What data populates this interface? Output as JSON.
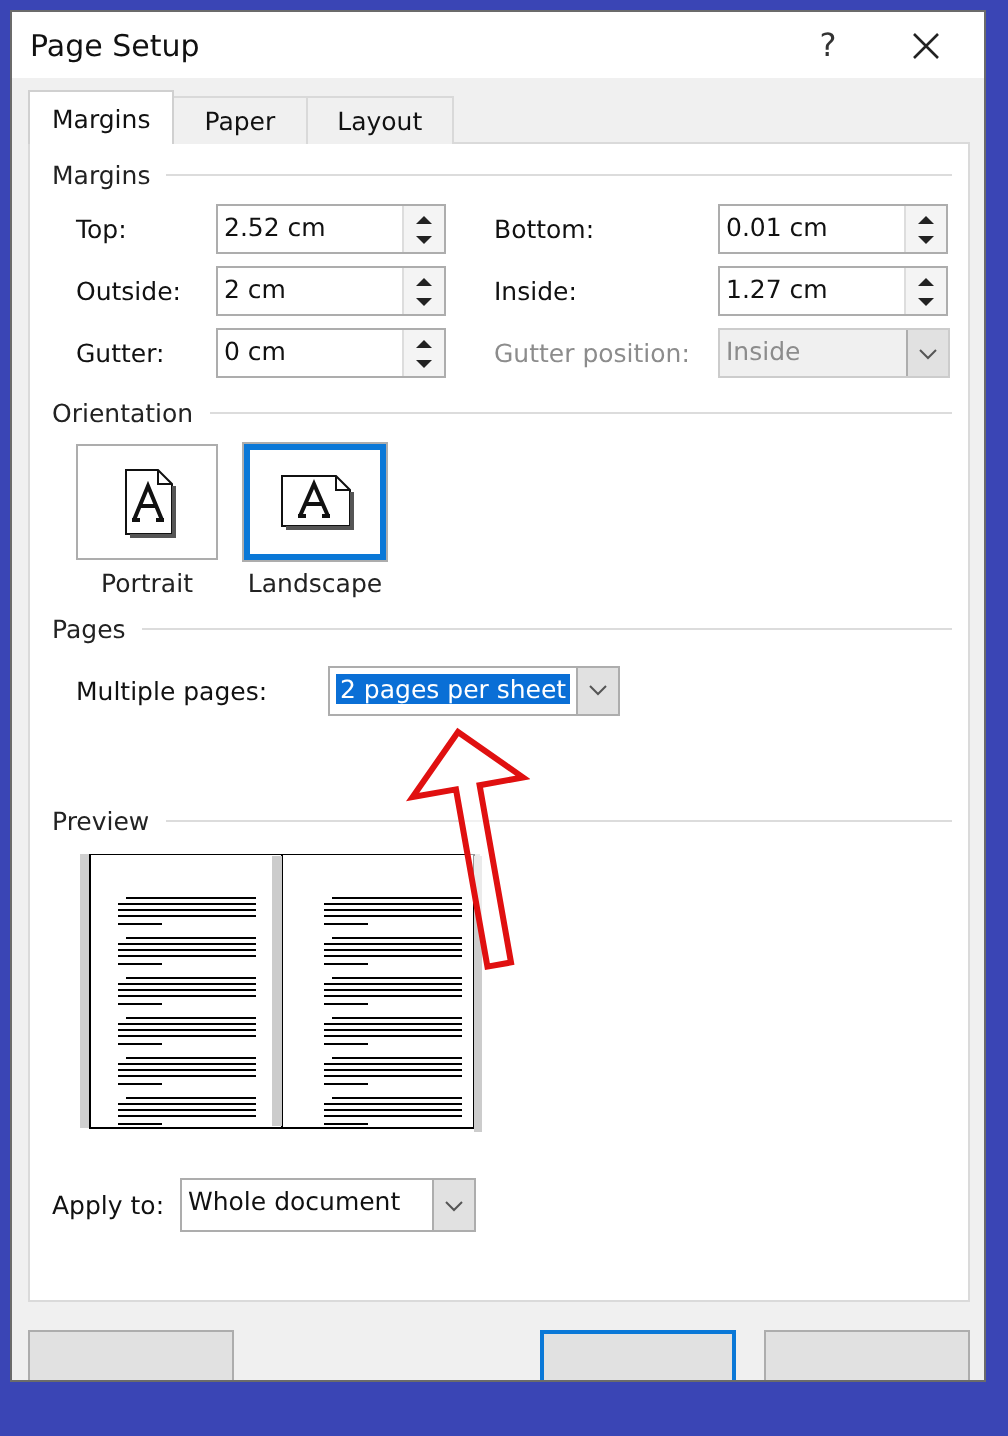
{
  "window": {
    "title": "Page Setup",
    "help": "?"
  },
  "tabs": [
    {
      "label": "Margins",
      "selected": true
    },
    {
      "label": "Paper",
      "selected": false
    },
    {
      "label": "Layout",
      "selected": false
    }
  ],
  "margins": {
    "heading": "Margins",
    "fields": [
      {
        "label": "Top:",
        "value": "2.52 cm",
        "kind": "spin",
        "disabled": false
      },
      {
        "label": "Bottom:",
        "value": "0.01 cm",
        "kind": "spin",
        "disabled": false
      },
      {
        "label": "Outside:",
        "value": "2 cm",
        "kind": "spin",
        "disabled": false
      },
      {
        "label": "Inside:",
        "value": "1.27 cm",
        "kind": "spin",
        "disabled": false
      },
      {
        "label": "Gutter:",
        "value": "0 cm",
        "kind": "spin",
        "disabled": false
      },
      {
        "label": "Gutter position:",
        "value": "Inside",
        "kind": "dropdown",
        "disabled": true
      }
    ]
  },
  "orientation": {
    "heading": "Orientation",
    "options": [
      {
        "label": "Portrait",
        "kind": "portrait",
        "selected": false
      },
      {
        "label": "Landscape",
        "kind": "landscape",
        "selected": true
      }
    ]
  },
  "pages": {
    "heading": "Pages",
    "multiple_pages": {
      "label": "Multiple pages:",
      "value": "2 pages per sheet"
    }
  },
  "preview": {
    "heading": "Preview"
  },
  "apply_to": {
    "label": "Apply to:",
    "value": "Whole document"
  }
}
